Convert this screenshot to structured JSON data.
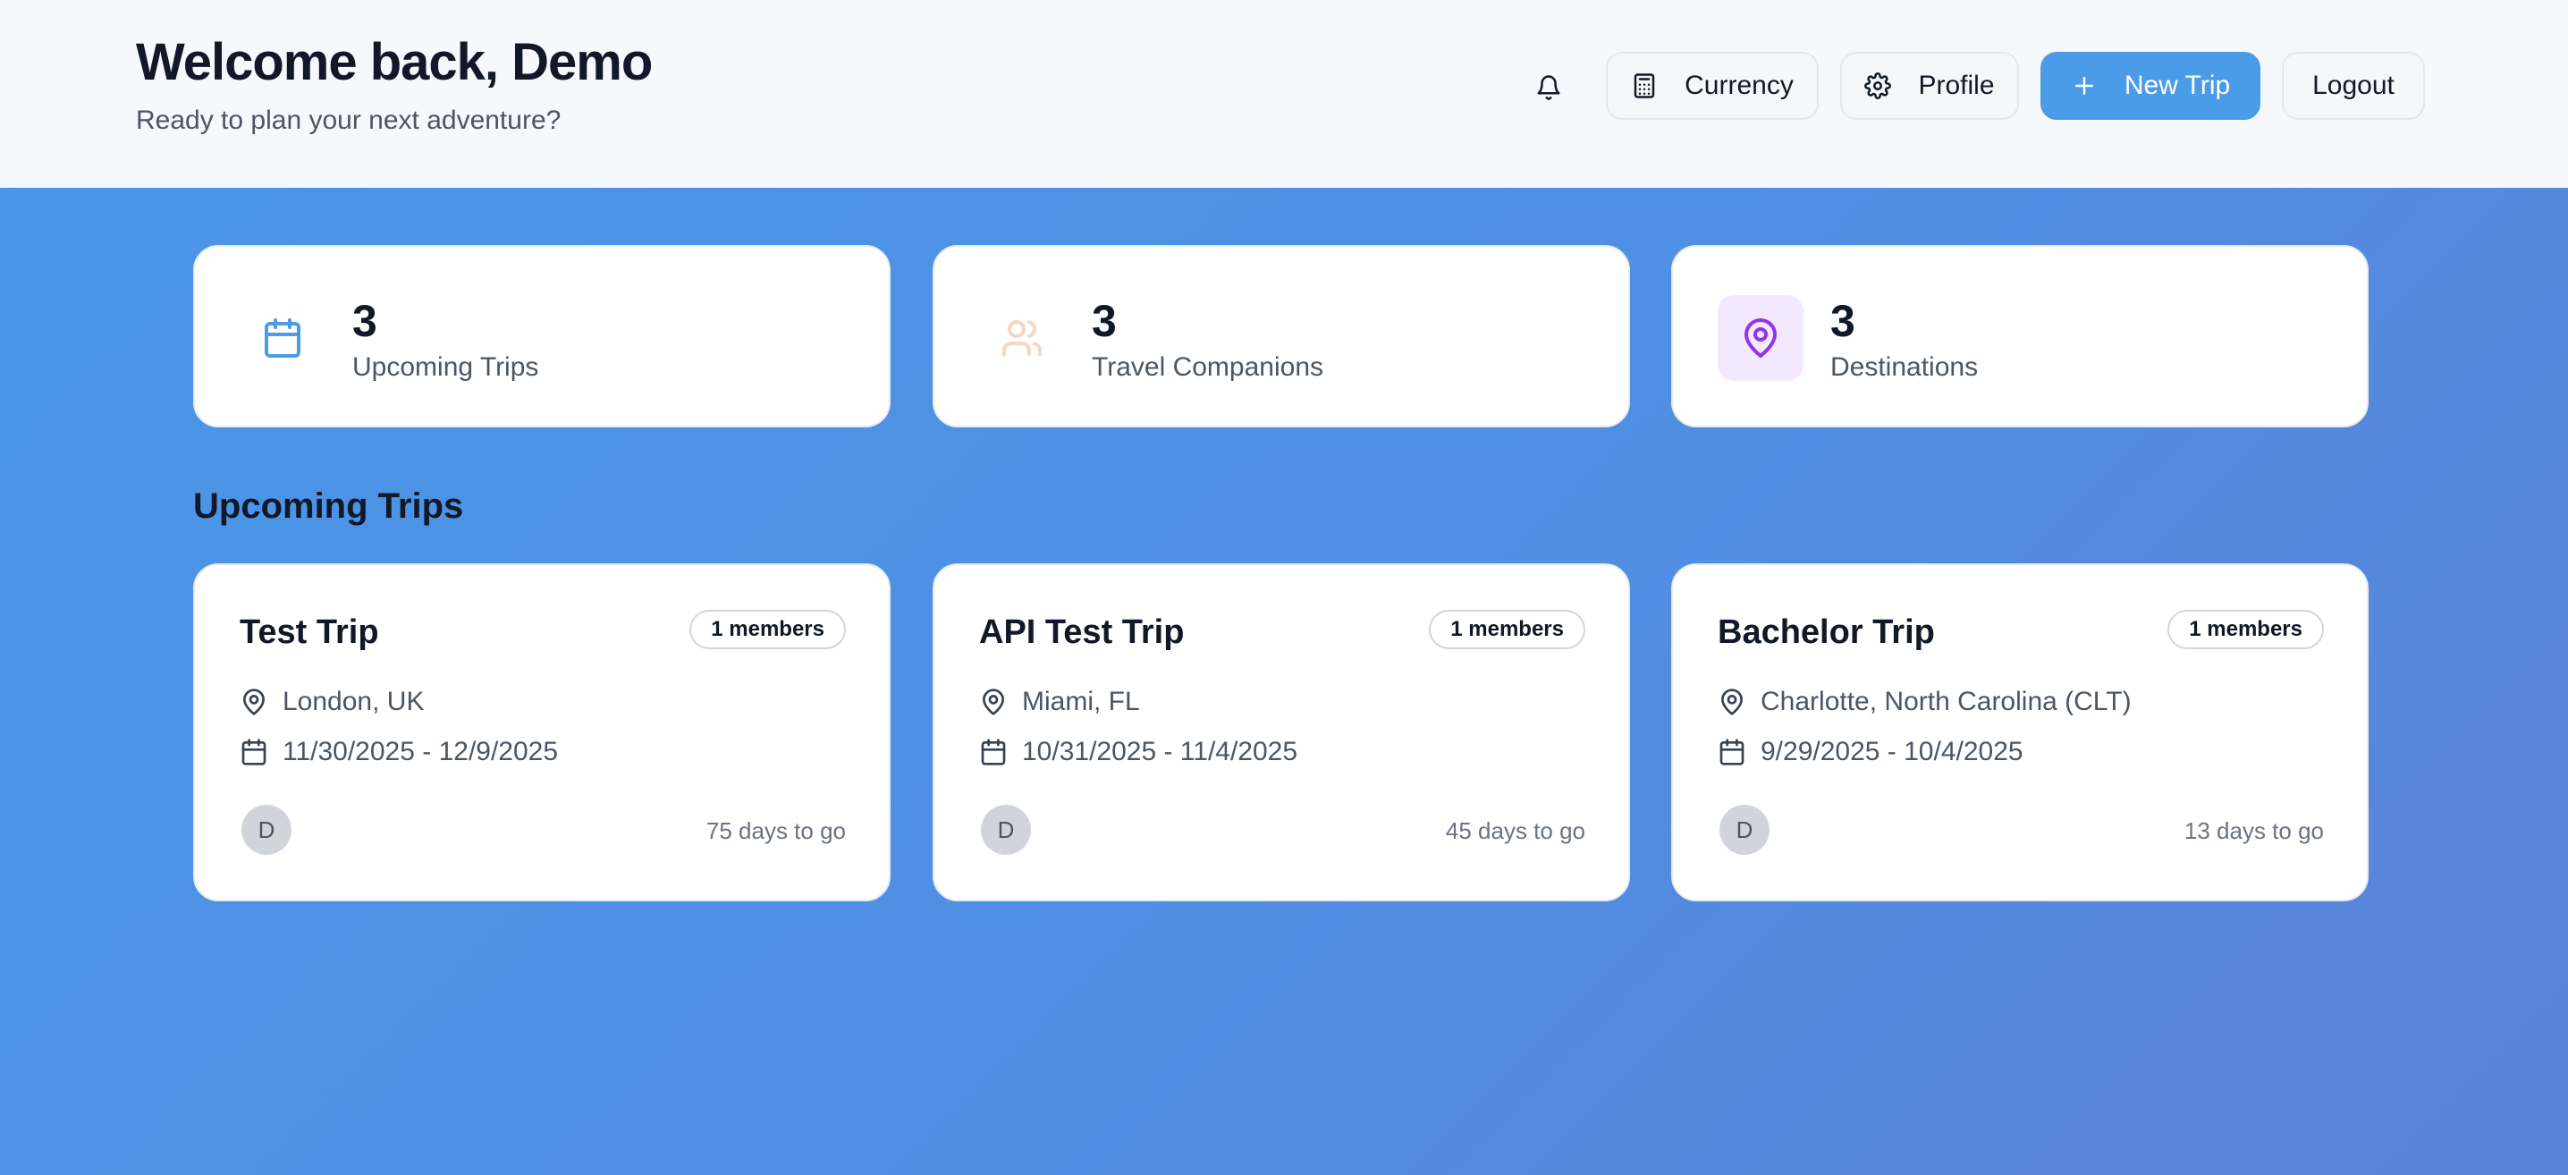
{
  "header": {
    "title": "Welcome back, Demo",
    "subtitle": "Ready to plan your next adventure?",
    "buttons": {
      "notifications_icon": "bell-icon",
      "currency": "Currency",
      "profile": "Profile",
      "new_trip": "New Trip",
      "logout": "Logout"
    }
  },
  "colors": {
    "accent": "#4a9be8",
    "calendar_icon": "#4a9be8",
    "companions_icon": "#f5d7c0",
    "destinations_icon": "#9333ea",
    "destinations_bg": "#f3e8ff"
  },
  "stats": [
    {
      "value": "3",
      "label": "Upcoming Trips",
      "icon": "calendar-icon"
    },
    {
      "value": "3",
      "label": "Travel Companions",
      "icon": "users-icon"
    },
    {
      "value": "3",
      "label": "Destinations",
      "icon": "map-pin-icon"
    }
  ],
  "section_title": "Upcoming Trips",
  "trips": [
    {
      "name": "Test Trip",
      "members": "1 members",
      "location": "London, UK",
      "dates": "11/30/2025 - 12/9/2025",
      "avatar": "D",
      "countdown": "75 days to go"
    },
    {
      "name": "API Test Trip",
      "members": "1 members",
      "location": "Miami, FL",
      "dates": "10/31/2025 - 11/4/2025",
      "avatar": "D",
      "countdown": "45 days to go"
    },
    {
      "name": "Bachelor Trip",
      "members": "1 members",
      "location": "Charlotte, North Carolina (CLT)",
      "dates": "9/29/2025 - 10/4/2025",
      "avatar": "D",
      "countdown": "13 days to go"
    }
  ]
}
